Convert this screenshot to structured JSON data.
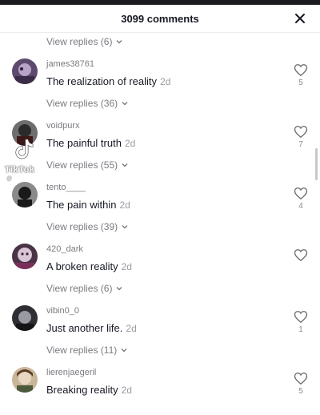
{
  "header": {
    "title": "3099 comments"
  },
  "top_view_replies": "View replies (6)",
  "comments": [
    {
      "username": "james38761",
      "text": "The realization of reality",
      "age": "2d",
      "likes": "5",
      "view_replies": "View replies (36)"
    },
    {
      "username": "voidpurx",
      "text": "The painful truth",
      "age": "2d",
      "likes": "7",
      "view_replies": "View replies (55)"
    },
    {
      "username": "tento____",
      "text": "The pain within",
      "age": "2d",
      "likes": "4",
      "view_replies": "View replies (39)"
    },
    {
      "username": "420_dark",
      "text": "A broken reality",
      "age": "2d",
      "likes": "",
      "view_replies": "View replies (6)"
    },
    {
      "username": "vibin0_0",
      "text": "Just another life.",
      "age": "2d",
      "likes": "1",
      "view_replies": "View replies (11)"
    },
    {
      "username": "lierenjaegeril",
      "text": "Breaking reality",
      "age": "2d",
      "likes": "5"
    }
  ],
  "watermark": {
    "brand": "TikTok",
    "handle": "@"
  },
  "colors": {
    "text": "#161823",
    "muted": "#7a7b80",
    "background": "#ffffff"
  },
  "icons": {
    "close": "close-icon",
    "like": "heart-outline-icon",
    "expand": "chevron-down-icon"
  }
}
